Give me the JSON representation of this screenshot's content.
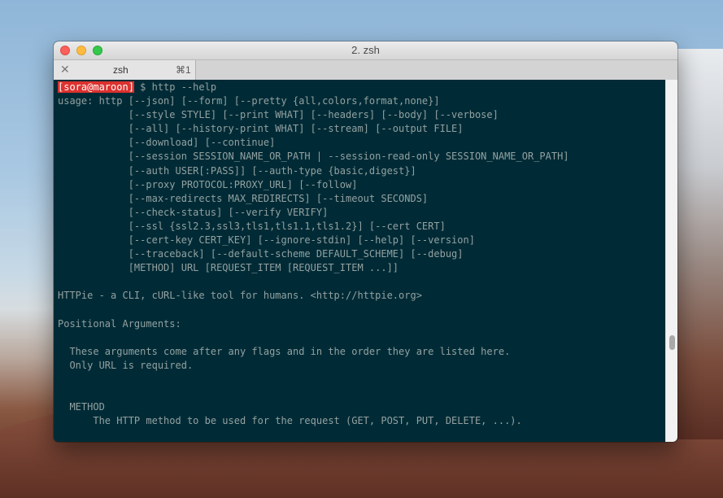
{
  "window": {
    "title": "2. zsh"
  },
  "tab": {
    "close_glyph": "✕",
    "title": "zsh",
    "shortcut": "⌘1"
  },
  "terminal": {
    "prompt_user": "[sora@maroon]",
    "prompt_rest": " $ http --help",
    "lines": [
      "usage: http [--json] [--form] [--pretty {all,colors,format,none}]",
      "            [--style STYLE] [--print WHAT] [--headers] [--body] [--verbose]",
      "            [--all] [--history-print WHAT] [--stream] [--output FILE]",
      "            [--download] [--continue]",
      "            [--session SESSION_NAME_OR_PATH | --session-read-only SESSION_NAME_OR_PATH]",
      "            [--auth USER[:PASS]] [--auth-type {basic,digest}]",
      "            [--proxy PROTOCOL:PROXY_URL] [--follow]",
      "            [--max-redirects MAX_REDIRECTS] [--timeout SECONDS]",
      "            [--check-status] [--verify VERIFY]",
      "            [--ssl {ssl2.3,ssl3,tls1,tls1.1,tls1.2}] [--cert CERT]",
      "            [--cert-key CERT_KEY] [--ignore-stdin] [--help] [--version]",
      "            [--traceback] [--default-scheme DEFAULT_SCHEME] [--debug]",
      "            [METHOD] URL [REQUEST_ITEM [REQUEST_ITEM ...]]",
      "",
      "HTTPie - a CLI, cURL-like tool for humans. <http://httpie.org>",
      "",
      "Positional Arguments:",
      "",
      "  These arguments come after any flags and in the order they are listed here.",
      "  Only URL is required.",
      "",
      "",
      "  METHOD",
      "      The HTTP method to be used for the request (GET, POST, PUT, DELETE, ...)."
    ]
  }
}
